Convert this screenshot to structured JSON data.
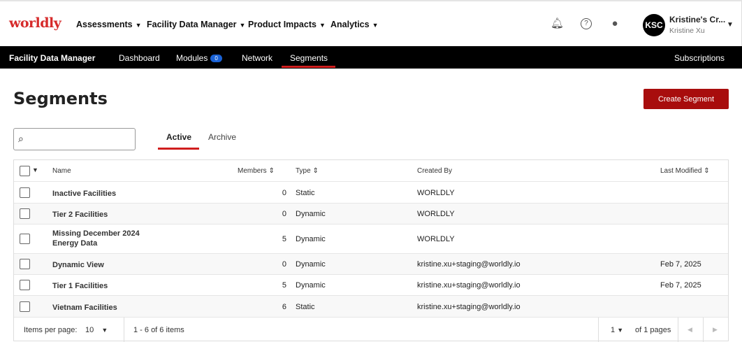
{
  "header": {
    "logo": "worldly",
    "menus": [
      "Assessments",
      "Facility Data Manager",
      "Product Impacts",
      "Analytics"
    ],
    "avatar": "KSC",
    "user_name": "Kristine's Cr...",
    "user_sub": "Kristine Xu"
  },
  "subnav": {
    "title": "Facility Data Manager",
    "items": [
      "Dashboard",
      "Modules",
      "Network",
      "Segments"
    ],
    "modules_count": "0",
    "right": "Subscriptions"
  },
  "page": {
    "title": "Segments",
    "create_label": "Create Segment",
    "search_placeholder": "",
    "tabs": [
      "Active",
      "Archive"
    ]
  },
  "table": {
    "columns": [
      "Name",
      "Members",
      "Type",
      "Created By",
      "Last Modified"
    ],
    "rows": [
      {
        "name": "Inactive Facilities",
        "members": "0",
        "type": "Static",
        "created_by": "WORLDLY",
        "modified": ""
      },
      {
        "name": "Tier 2 Facilities",
        "members": "0",
        "type": "Dynamic",
        "created_by": "WORLDLY",
        "modified": ""
      },
      {
        "name": "Missing December 2024 Energy Data",
        "members": "5",
        "type": "Dynamic",
        "created_by": "WORLDLY",
        "modified": ""
      },
      {
        "name": "Dynamic View",
        "members": "0",
        "type": "Dynamic",
        "created_by": "kristine.xu+staging@worldly.io",
        "modified": "Feb 7, 2025"
      },
      {
        "name": "Tier 1 Facilities",
        "members": "5",
        "type": "Dynamic",
        "created_by": "kristine.xu+staging@worldly.io",
        "modified": "Feb 7, 2025"
      },
      {
        "name": "Vietnam Facilities",
        "members": "6",
        "type": "Static",
        "created_by": "kristine.xu+staging@worldly.io",
        "modified": ""
      }
    ]
  },
  "footer": {
    "items_per_page_label": "Items per page:",
    "items_per_page": "10",
    "range": "1 - 6 of 6 items",
    "page": "1",
    "of_pages": "of 1 pages"
  }
}
